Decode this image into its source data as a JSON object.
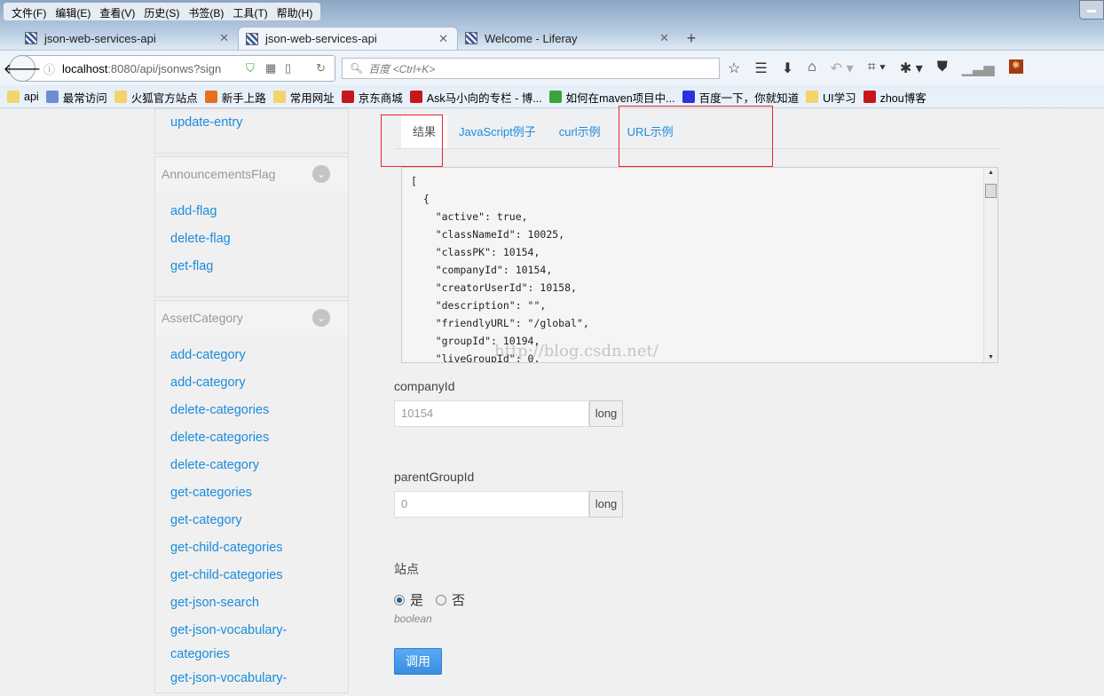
{
  "menu": [
    "文件(F)",
    "编辑(E)",
    "查看(V)",
    "历史(S)",
    "书签(B)",
    "工具(T)",
    "帮助(H)"
  ],
  "tabs": [
    {
      "title": "json-web-services-api"
    },
    {
      "title": "json-web-services-api"
    },
    {
      "title": "Welcome - Liferay"
    }
  ],
  "url": {
    "host": "localhost",
    "rest": ":8080/api/jsonws?sign"
  },
  "search_placeholder": "百度 <Ctrl+K>",
  "bookmarks": [
    {
      "label": "api",
      "color": "#f2d46b"
    },
    {
      "label": "最常访问",
      "color": "#6b8fd0"
    },
    {
      "label": "火狐官方站点",
      "color": "#f2d46b"
    },
    {
      "label": "新手上路",
      "color": "#e5701f"
    },
    {
      "label": "常用网址",
      "color": "#f2d46b"
    },
    {
      "label": "京东商城",
      "color": "#c8161d"
    },
    {
      "label": "Ask马小向的专栏 - 博...",
      "color": "#c8161d"
    },
    {
      "label": "如何在maven项目中...",
      "color": "#3aa33a"
    },
    {
      "label": "百度一下，你就知道",
      "color": "#2932e1"
    },
    {
      "label": "UI学习",
      "color": "#f2d46b"
    },
    {
      "label": "zhou博客",
      "color": "#c8161d"
    }
  ],
  "sidebar": {
    "top_item": "update-entry",
    "panels": [
      {
        "title": "AnnouncementsFlag",
        "items": [
          "add-flag",
          "delete-flag",
          "get-flag"
        ]
      },
      {
        "title": "AssetCategory",
        "items": [
          "add-category",
          "add-category",
          "delete-categories",
          "delete-categories",
          "delete-category",
          "get-categories",
          "get-category",
          "get-child-categories",
          "get-child-categories",
          "get-json-search",
          "get-json-vocabulary-",
          "categories",
          "get-json-vocabulary-"
        ]
      }
    ]
  },
  "main": {
    "tabs": [
      "结果",
      "JavaScript例子",
      "curl示例",
      "URL示例"
    ],
    "result": "[\n  {\n    \"active\": true,\n    \"classNameId\": 10025,\n    \"classPK\": 10154,\n    \"companyId\": 10154,\n    \"creatorUserId\": 10158,\n    \"description\": \"\",\n    \"friendlyURL\": \"/global\",\n    \"groupId\": 10194,\n    \"liveGroupId\": 0,",
    "watermark": "http://blog.csdn.net/",
    "fields": [
      {
        "label": "companyId",
        "value": "10154",
        "type": "long"
      },
      {
        "label": "parentGroupId",
        "value": "0",
        "type": "long"
      }
    ],
    "site": {
      "label": "站点",
      "yes": "是",
      "no": "否",
      "type": "boolean",
      "selected": "yes"
    },
    "invoke": "调用"
  }
}
